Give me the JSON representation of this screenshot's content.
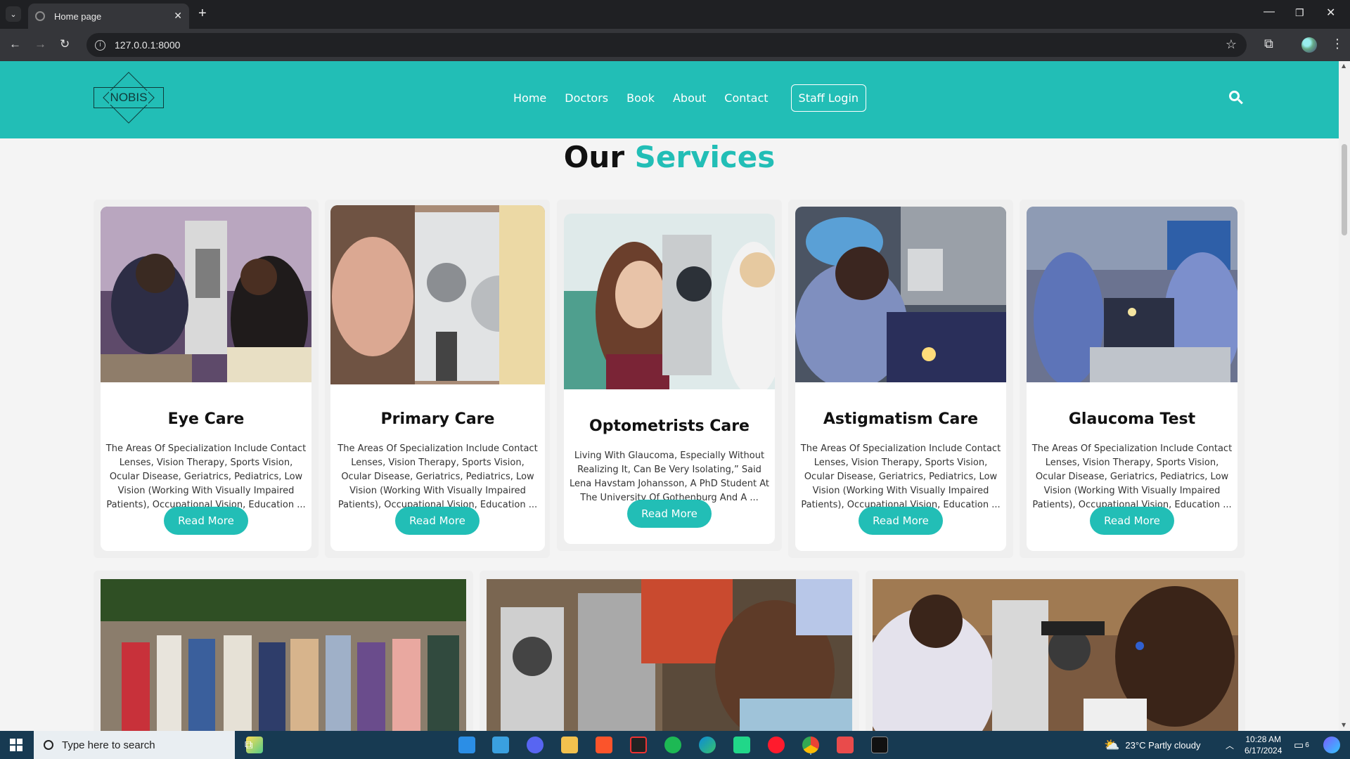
{
  "browser": {
    "tab_title": "Home page",
    "url": "127.0.0.1:8000"
  },
  "site": {
    "logo_text": "NOBIS",
    "nav": [
      "Home",
      "Doctors",
      "Book",
      "About",
      "Contact"
    ],
    "staff_login": "Staff Login",
    "accent_color": "#22beb6"
  },
  "section": {
    "title_part1": "Our",
    "title_part2": "Services"
  },
  "services": [
    {
      "title": "Eye Care",
      "text": "The Areas Of Specialization Include Contact Lenses, Vision Therapy, Sports Vision, Ocular Disease, Geriatrics, Pediatrics, Low Vision (Working With Visually Impaired Patients), Occupational Vision, Education ...",
      "button": "Read More"
    },
    {
      "title": "Primary Care",
      "text": "The Areas Of Specialization Include Contact Lenses, Vision Therapy, Sports Vision, Ocular Disease, Geriatrics, Pediatrics, Low Vision (Working With Visually Impaired Patients), Occupational Vision, Education ...",
      "button": "Read More"
    },
    {
      "title": "Optometrists Care",
      "text": "Living With Glaucoma, Especially Without Realizing It, Can Be Very Isolating,” Said Lena Havstam Johansson, A PhD Student At The University Of Gothenburg And A ...",
      "button": "Read More"
    },
    {
      "title": "Astigmatism Care",
      "text": "The Areas Of Specialization Include Contact Lenses, Vision Therapy, Sports Vision, Ocular Disease, Geriatrics, Pediatrics, Low Vision (Working With Visually Impaired Patients), Occupational Vision, Education ...",
      "button": "Read More"
    },
    {
      "title": "Glaucoma Test",
      "text": "The Areas Of Specialization Include Contact Lenses, Vision Therapy, Sports Vision, Ocular Disease, Geriatrics, Pediatrics, Low Vision (Working With Visually Impaired Patients), Occupational Vision, Education ...",
      "button": "Read More"
    }
  ],
  "taskbar": {
    "search_placeholder": "Type here to search",
    "weather": "23°C  Partly cloudy",
    "time": "10:28 AM",
    "date": "6/17/2024",
    "notifications": "6"
  }
}
